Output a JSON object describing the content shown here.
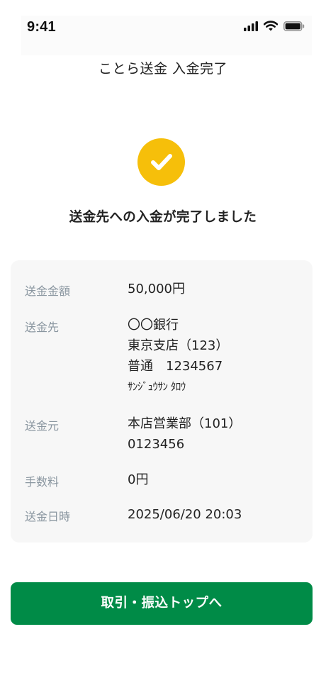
{
  "status_bar": {
    "time": "9:41",
    "icons": [
      "cellular-signal-icon",
      "wifi-icon",
      "battery-icon"
    ]
  },
  "header": {
    "title": "ことら送金 入金完了"
  },
  "result": {
    "icon": "checkmark-icon",
    "icon_color": "#f6bf0a",
    "message": "送金先への入金が完了しました"
  },
  "details": {
    "amount": {
      "label": "送金金額",
      "value": "50,000円"
    },
    "recipient": {
      "label": "送金先",
      "bank": "〇〇銀行",
      "branch": "東京支店（123）",
      "account": "普通　1234567",
      "name": "ｻﾝｼﾞｭｳｻﾝ ﾀﾛｳ"
    },
    "source": {
      "label": "送金元",
      "branch": "本店営業部（101）",
      "account": "0123456"
    },
    "fee": {
      "label": "手数料",
      "value": "0円"
    },
    "datetime": {
      "label": "送金日時",
      "value": "2025/06/20 20:03"
    }
  },
  "actions": {
    "primary_label": "取引・振込トップへ",
    "primary_color": "#008b47"
  }
}
